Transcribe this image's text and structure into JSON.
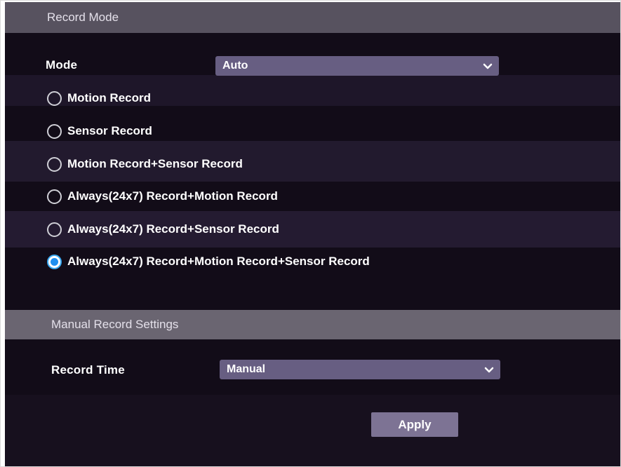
{
  "record_mode": {
    "header": "Record Mode",
    "mode_label": "Mode",
    "mode_value": "Auto",
    "options": [
      {
        "label": "Motion Record",
        "checked": false
      },
      {
        "label": "Sensor Record",
        "checked": false
      },
      {
        "label": "Motion Record+Sensor Record",
        "checked": false
      },
      {
        "label": "Always(24x7) Record+Motion Record",
        "checked": false
      },
      {
        "label": "Always(24x7) Record+Sensor Record",
        "checked": false
      },
      {
        "label": "Always(24x7) Record+Motion Record+Sensor Record",
        "checked": true
      }
    ]
  },
  "manual_settings": {
    "header": "Manual Record Settings",
    "record_time_label": "Record Time",
    "record_time_value": "Manual"
  },
  "actions": {
    "apply_label": "Apply"
  },
  "colors": {
    "background": "#120c18",
    "header": "#5b5663",
    "select": "#675e82",
    "button": "#7d7394",
    "radio_selected": "#1e8ff0"
  },
  "icons": {
    "select_arrow": "chevron-down-icon"
  }
}
